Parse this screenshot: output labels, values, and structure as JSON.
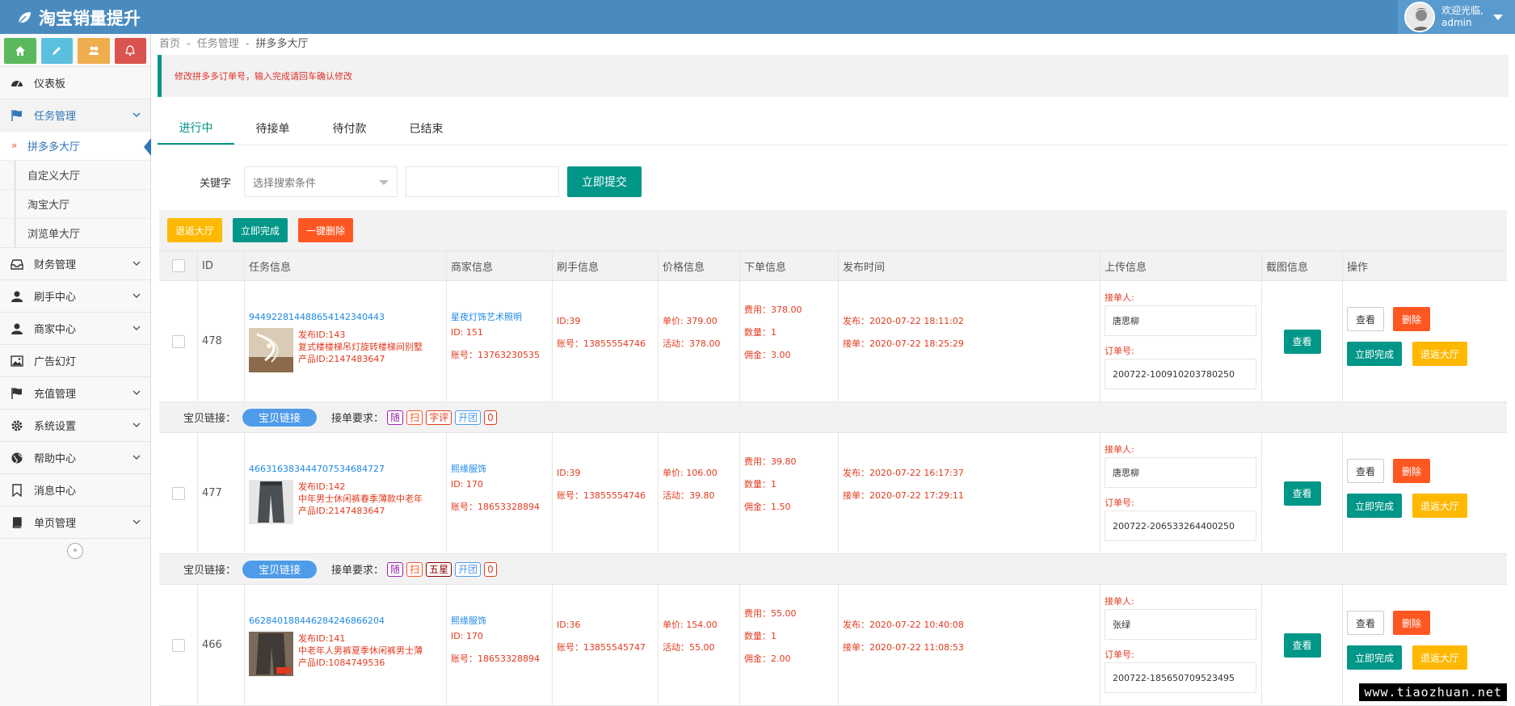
{
  "header": {
    "brand": "淘宝销量提升",
    "welcome": "欢迎光临,",
    "username": "admin"
  },
  "sidebar": {
    "items": [
      {
        "label": "仪表板"
      },
      {
        "label": "任务管理"
      },
      {
        "label": "财务管理"
      },
      {
        "label": "刷手中心"
      },
      {
        "label": "商家中心"
      },
      {
        "label": "广告幻灯"
      },
      {
        "label": "充值管理"
      },
      {
        "label": "系统设置"
      },
      {
        "label": "帮助中心"
      },
      {
        "label": "消息中心"
      },
      {
        "label": "单页管理"
      }
    ],
    "sub": [
      "拼多多大厅",
      "自定义大厅",
      "淘宝大厅",
      "浏览单大厅"
    ],
    "collapse": "«"
  },
  "breadcrumb": {
    "home": "首页",
    "section": "任务管理",
    "current": "拼多多大厅",
    "sep": "-"
  },
  "notice": "修改拼多多订单号，输入完成请回车确认修改",
  "tabs": [
    "进行中",
    "待接单",
    "待付款",
    "已结束"
  ],
  "search": {
    "label": "关键字",
    "select_placeholder": "选择搜索条件",
    "submit": "立即提交"
  },
  "toolbar": {
    "back": "退返大厅",
    "complete": "立即完成",
    "delete": "一键删除"
  },
  "columns": [
    "ID",
    "任务信息",
    "商家信息",
    "刷手信息",
    "价格信息",
    "下单信息",
    "发布时间",
    "上传信息",
    "截图信息",
    "操作"
  ],
  "rows": [
    {
      "id": "478",
      "task_no": "944922814488654142340443",
      "publish_id": "发布ID:143",
      "title": "复式楼楼梯吊灯旋转楼梯间别墅",
      "product_id": "产品ID:2147483647",
      "shop": "星夜灯饰艺术照明",
      "shop_id": "ID: 151",
      "shop_account": "账号：13763230535",
      "brush_id": "ID:39",
      "brush_account": "账号：13855554746",
      "unit_price": "单价: 379.00",
      "activity": "活动：378.00",
      "fee": "费用：378.00",
      "qty": "数量：1",
      "commission": "佣金：3.00",
      "publish_time": "发布：2020-07-22 18:11:02",
      "accept_time": "接单：2020-07-22 18:25:29",
      "receiver_label": "接单人:",
      "receiver": "唐思柳",
      "order_label": "订单号:",
      "order_no": "200722-100910203780250"
    },
    {
      "id": "477",
      "task_no": "466316383444707534684727",
      "publish_id": "发布ID:142",
      "title": "中年男士休闲裤春季薄款中老年",
      "product_id": "产品ID:2147483647",
      "shop": "熙缘服饰",
      "shop_id": "ID: 170",
      "shop_account": "账号：18653328894",
      "brush_id": "ID:39",
      "brush_account": "账号：13855554746",
      "unit_price": "单价: 106.00",
      "activity": "活动：39.80",
      "fee": "费用：39.80",
      "qty": "数量：1",
      "commission": "佣金：1.50",
      "publish_time": "发布：2020-07-22 16:17:37",
      "accept_time": "接单：2020-07-22 17:29:11",
      "receiver_label": "接单人:",
      "receiver": "唐思柳",
      "order_label": "订单号:",
      "order_no": "200722-206533264400250"
    },
    {
      "id": "466",
      "task_no": "662840188446284246866204",
      "publish_id": "发布ID:141",
      "title": "中老年人男裤夏季休闲裤男士薄",
      "product_id": "产品ID:1084749536",
      "shop": "熙缘服饰",
      "shop_id": "ID: 170",
      "shop_account": "账号：18653328894",
      "brush_id": "ID:36",
      "brush_account": "账号：13855545747",
      "unit_price": "单价: 154.00",
      "activity": "活动：55.00",
      "fee": "费用：55.00",
      "qty": "数量：1",
      "commission": "佣金：2.00",
      "publish_time": "发布：2020-07-22 10:40:08",
      "accept_time": "接单：2020-07-22 11:08:53",
      "receiver_label": "接单人:",
      "receiver": "张绿",
      "order_label": "订单号:",
      "order_no": "200722-185650709523495"
    }
  ],
  "row_buttons": {
    "view": "查看",
    "check": "查看",
    "delete": "删除",
    "complete": "立即完成",
    "back": "退返大厅"
  },
  "link_rows": [
    {
      "label": "宝贝链接：",
      "pill": "宝贝链接",
      "req": "接单要求：",
      "tags": [
        "随",
        "扫",
        "字评",
        "开团",
        "0"
      ]
    },
    {
      "label": "宝贝链接：",
      "pill": "宝贝链接",
      "req": "接单要求：",
      "tags": [
        "随",
        "扫",
        "五星",
        "开团",
        "0"
      ]
    }
  ],
  "watermark": "www.tiaozhuan.net",
  "colors": {
    "topbar": "#4a8bbf",
    "accent": "#009688",
    "danger": "#ff5722",
    "warn": "#ffb800",
    "link": "#1e88e5"
  }
}
